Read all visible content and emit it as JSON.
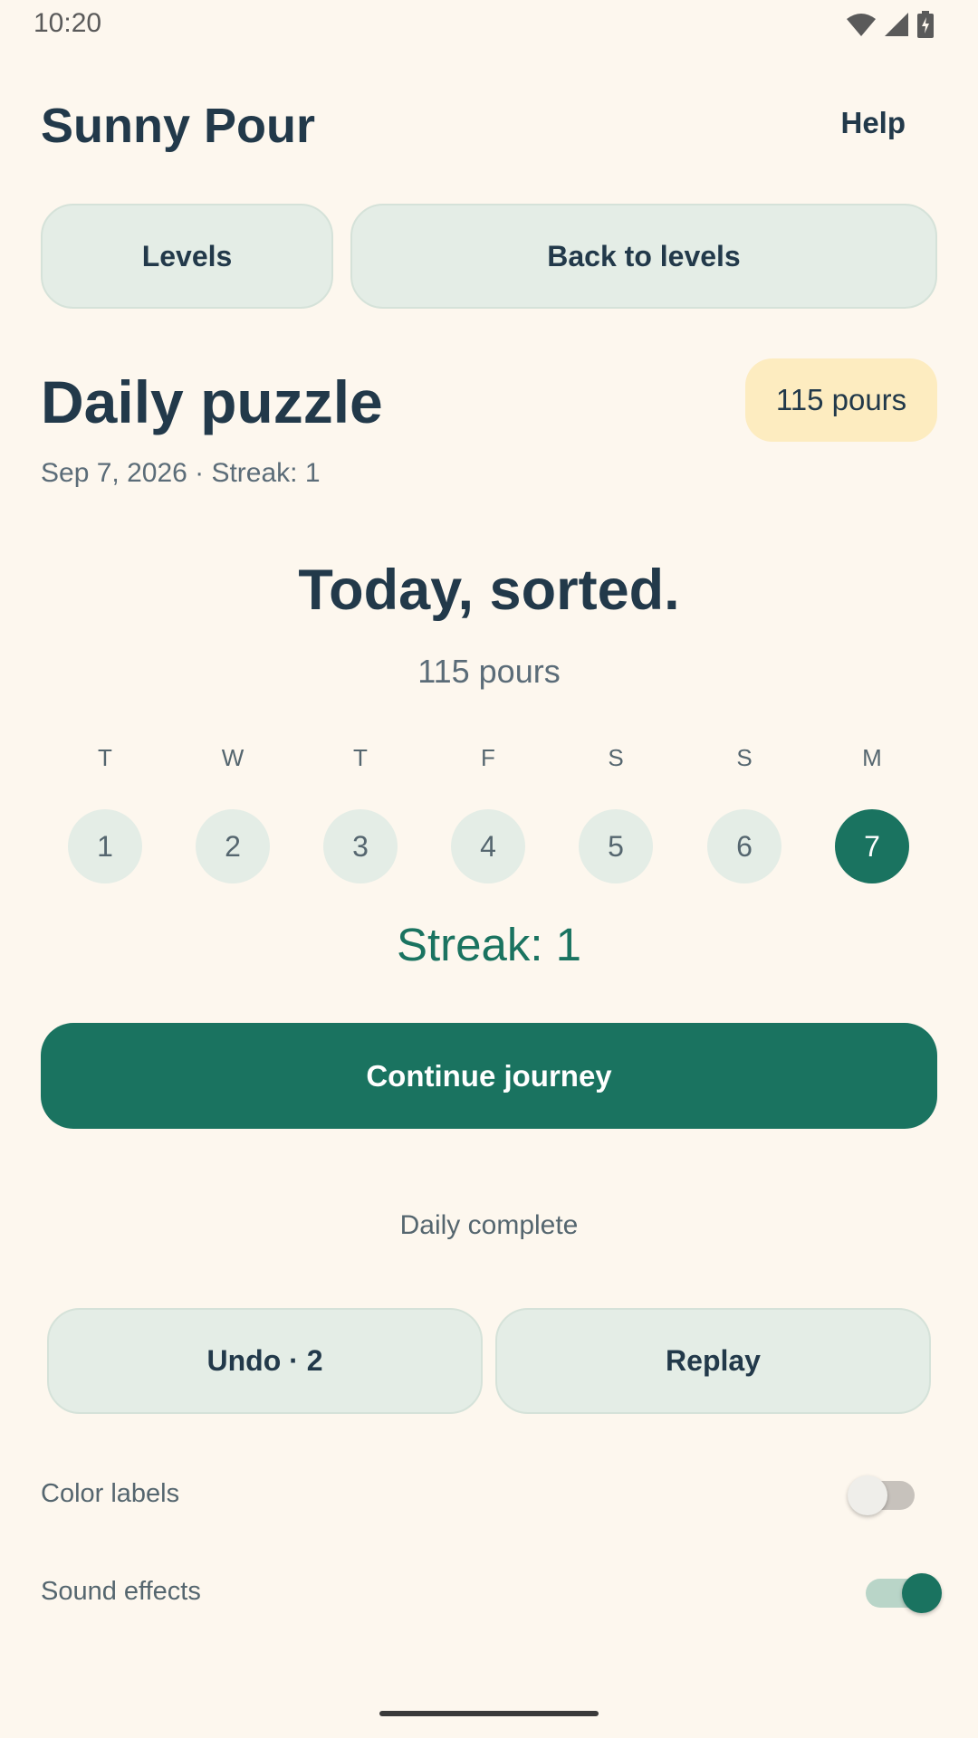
{
  "status_bar": {
    "time": "10:20",
    "icons": [
      "wifi-icon",
      "signal-icon",
      "battery-charging-icon"
    ]
  },
  "header": {
    "title": "Sunny Pour",
    "help_label": "Help"
  },
  "nav": {
    "levels_label": "Levels",
    "back_label": "Back to levels"
  },
  "puzzle": {
    "title": "Daily puzzle",
    "pours_badge": "115 pours",
    "date_line": "Sep 7, 2026 · Streak: 1"
  },
  "completion": {
    "heading": "Today, sorted.",
    "pours": "115 pours",
    "week": [
      {
        "letter": "T",
        "number": "1",
        "active": false
      },
      {
        "letter": "W",
        "number": "2",
        "active": false
      },
      {
        "letter": "T",
        "number": "3",
        "active": false
      },
      {
        "letter": "F",
        "number": "4",
        "active": false
      },
      {
        "letter": "S",
        "number": "5",
        "active": false
      },
      {
        "letter": "S",
        "number": "6",
        "active": false
      },
      {
        "letter": "M",
        "number": "7",
        "active": true
      }
    ],
    "streak": "Streak: 1",
    "continue_label": "Continue journey",
    "status": "Daily complete"
  },
  "actions": {
    "undo_label": "Undo · 2",
    "replay_label": "Replay"
  },
  "settings": {
    "color_labels": {
      "label": "Color labels",
      "enabled": false
    },
    "sound_effects": {
      "label": "Sound effects",
      "enabled": true
    }
  },
  "colors": {
    "background": "#fdf7ee",
    "accent": "#1a7360",
    "badge": "#fdecc0",
    "secondary_button": "#e4ede6",
    "text": "#22394a"
  }
}
